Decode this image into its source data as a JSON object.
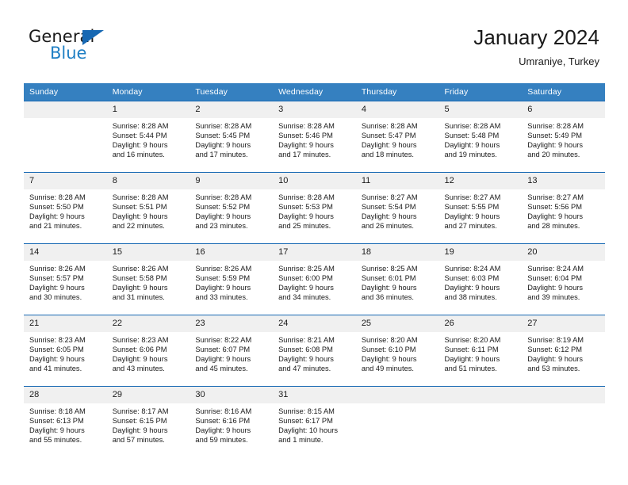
{
  "brand": {
    "name_part1": "General",
    "name_part2": "Blue",
    "triangle_color": "#1668b3",
    "blue_color": "#1f7fc4"
  },
  "header": {
    "title": "January 2024",
    "subtitle": "Umraniye, Turkey"
  },
  "theme": {
    "header_bar": "#3580c0",
    "rule": "#1668b3",
    "daynum_band": "#f0f0f0"
  },
  "weekday_headers": [
    "Sunday",
    "Monday",
    "Tuesday",
    "Wednesday",
    "Thursday",
    "Friday",
    "Saturday"
  ],
  "weeks": [
    [
      {
        "day": "",
        "empty": true,
        "sunrise": "",
        "sunset": "",
        "daylight_line1": "",
        "daylight_line2": ""
      },
      {
        "day": "1",
        "sunrise": "Sunrise: 8:28 AM",
        "sunset": "Sunset: 5:44 PM",
        "daylight_line1": "Daylight: 9 hours",
        "daylight_line2": "and 16 minutes."
      },
      {
        "day": "2",
        "sunrise": "Sunrise: 8:28 AM",
        "sunset": "Sunset: 5:45 PM",
        "daylight_line1": "Daylight: 9 hours",
        "daylight_line2": "and 17 minutes."
      },
      {
        "day": "3",
        "sunrise": "Sunrise: 8:28 AM",
        "sunset": "Sunset: 5:46 PM",
        "daylight_line1": "Daylight: 9 hours",
        "daylight_line2": "and 17 minutes."
      },
      {
        "day": "4",
        "sunrise": "Sunrise: 8:28 AM",
        "sunset": "Sunset: 5:47 PM",
        "daylight_line1": "Daylight: 9 hours",
        "daylight_line2": "and 18 minutes."
      },
      {
        "day": "5",
        "sunrise": "Sunrise: 8:28 AM",
        "sunset": "Sunset: 5:48 PM",
        "daylight_line1": "Daylight: 9 hours",
        "daylight_line2": "and 19 minutes."
      },
      {
        "day": "6",
        "sunrise": "Sunrise: 8:28 AM",
        "sunset": "Sunset: 5:49 PM",
        "daylight_line1": "Daylight: 9 hours",
        "daylight_line2": "and 20 minutes."
      }
    ],
    [
      {
        "day": "7",
        "sunrise": "Sunrise: 8:28 AM",
        "sunset": "Sunset: 5:50 PM",
        "daylight_line1": "Daylight: 9 hours",
        "daylight_line2": "and 21 minutes."
      },
      {
        "day": "8",
        "sunrise": "Sunrise: 8:28 AM",
        "sunset": "Sunset: 5:51 PM",
        "daylight_line1": "Daylight: 9 hours",
        "daylight_line2": "and 22 minutes."
      },
      {
        "day": "9",
        "sunrise": "Sunrise: 8:28 AM",
        "sunset": "Sunset: 5:52 PM",
        "daylight_line1": "Daylight: 9 hours",
        "daylight_line2": "and 23 minutes."
      },
      {
        "day": "10",
        "sunrise": "Sunrise: 8:28 AM",
        "sunset": "Sunset: 5:53 PM",
        "daylight_line1": "Daylight: 9 hours",
        "daylight_line2": "and 25 minutes."
      },
      {
        "day": "11",
        "sunrise": "Sunrise: 8:27 AM",
        "sunset": "Sunset: 5:54 PM",
        "daylight_line1": "Daylight: 9 hours",
        "daylight_line2": "and 26 minutes."
      },
      {
        "day": "12",
        "sunrise": "Sunrise: 8:27 AM",
        "sunset": "Sunset: 5:55 PM",
        "daylight_line1": "Daylight: 9 hours",
        "daylight_line2": "and 27 minutes."
      },
      {
        "day": "13",
        "sunrise": "Sunrise: 8:27 AM",
        "sunset": "Sunset: 5:56 PM",
        "daylight_line1": "Daylight: 9 hours",
        "daylight_line2": "and 28 minutes."
      }
    ],
    [
      {
        "day": "14",
        "sunrise": "Sunrise: 8:26 AM",
        "sunset": "Sunset: 5:57 PM",
        "daylight_line1": "Daylight: 9 hours",
        "daylight_line2": "and 30 minutes."
      },
      {
        "day": "15",
        "sunrise": "Sunrise: 8:26 AM",
        "sunset": "Sunset: 5:58 PM",
        "daylight_line1": "Daylight: 9 hours",
        "daylight_line2": "and 31 minutes."
      },
      {
        "day": "16",
        "sunrise": "Sunrise: 8:26 AM",
        "sunset": "Sunset: 5:59 PM",
        "daylight_line1": "Daylight: 9 hours",
        "daylight_line2": "and 33 minutes."
      },
      {
        "day": "17",
        "sunrise": "Sunrise: 8:25 AM",
        "sunset": "Sunset: 6:00 PM",
        "daylight_line1": "Daylight: 9 hours",
        "daylight_line2": "and 34 minutes."
      },
      {
        "day": "18",
        "sunrise": "Sunrise: 8:25 AM",
        "sunset": "Sunset: 6:01 PM",
        "daylight_line1": "Daylight: 9 hours",
        "daylight_line2": "and 36 minutes."
      },
      {
        "day": "19",
        "sunrise": "Sunrise: 8:24 AM",
        "sunset": "Sunset: 6:03 PM",
        "daylight_line1": "Daylight: 9 hours",
        "daylight_line2": "and 38 minutes."
      },
      {
        "day": "20",
        "sunrise": "Sunrise: 8:24 AM",
        "sunset": "Sunset: 6:04 PM",
        "daylight_line1": "Daylight: 9 hours",
        "daylight_line2": "and 39 minutes."
      }
    ],
    [
      {
        "day": "21",
        "sunrise": "Sunrise: 8:23 AM",
        "sunset": "Sunset: 6:05 PM",
        "daylight_line1": "Daylight: 9 hours",
        "daylight_line2": "and 41 minutes."
      },
      {
        "day": "22",
        "sunrise": "Sunrise: 8:23 AM",
        "sunset": "Sunset: 6:06 PM",
        "daylight_line1": "Daylight: 9 hours",
        "daylight_line2": "and 43 minutes."
      },
      {
        "day": "23",
        "sunrise": "Sunrise: 8:22 AM",
        "sunset": "Sunset: 6:07 PM",
        "daylight_line1": "Daylight: 9 hours",
        "daylight_line2": "and 45 minutes."
      },
      {
        "day": "24",
        "sunrise": "Sunrise: 8:21 AM",
        "sunset": "Sunset: 6:08 PM",
        "daylight_line1": "Daylight: 9 hours",
        "daylight_line2": "and 47 minutes."
      },
      {
        "day": "25",
        "sunrise": "Sunrise: 8:20 AM",
        "sunset": "Sunset: 6:10 PM",
        "daylight_line1": "Daylight: 9 hours",
        "daylight_line2": "and 49 minutes."
      },
      {
        "day": "26",
        "sunrise": "Sunrise: 8:20 AM",
        "sunset": "Sunset: 6:11 PM",
        "daylight_line1": "Daylight: 9 hours",
        "daylight_line2": "and 51 minutes."
      },
      {
        "day": "27",
        "sunrise": "Sunrise: 8:19 AM",
        "sunset": "Sunset: 6:12 PM",
        "daylight_line1": "Daylight: 9 hours",
        "daylight_line2": "and 53 minutes."
      }
    ],
    [
      {
        "day": "28",
        "sunrise": "Sunrise: 8:18 AM",
        "sunset": "Sunset: 6:13 PM",
        "daylight_line1": "Daylight: 9 hours",
        "daylight_line2": "and 55 minutes."
      },
      {
        "day": "29",
        "sunrise": "Sunrise: 8:17 AM",
        "sunset": "Sunset: 6:15 PM",
        "daylight_line1": "Daylight: 9 hours",
        "daylight_line2": "and 57 minutes."
      },
      {
        "day": "30",
        "sunrise": "Sunrise: 8:16 AM",
        "sunset": "Sunset: 6:16 PM",
        "daylight_line1": "Daylight: 9 hours",
        "daylight_line2": "and 59 minutes."
      },
      {
        "day": "31",
        "sunrise": "Sunrise: 8:15 AM",
        "sunset": "Sunset: 6:17 PM",
        "daylight_line1": "Daylight: 10 hours",
        "daylight_line2": "and 1 minute."
      },
      {
        "day": "",
        "empty": true,
        "sunrise": "",
        "sunset": "",
        "daylight_line1": "",
        "daylight_line2": ""
      },
      {
        "day": "",
        "empty": true,
        "sunrise": "",
        "sunset": "",
        "daylight_line1": "",
        "daylight_line2": ""
      },
      {
        "day": "",
        "empty": true,
        "sunrise": "",
        "sunset": "",
        "daylight_line1": "",
        "daylight_line2": ""
      }
    ]
  ]
}
